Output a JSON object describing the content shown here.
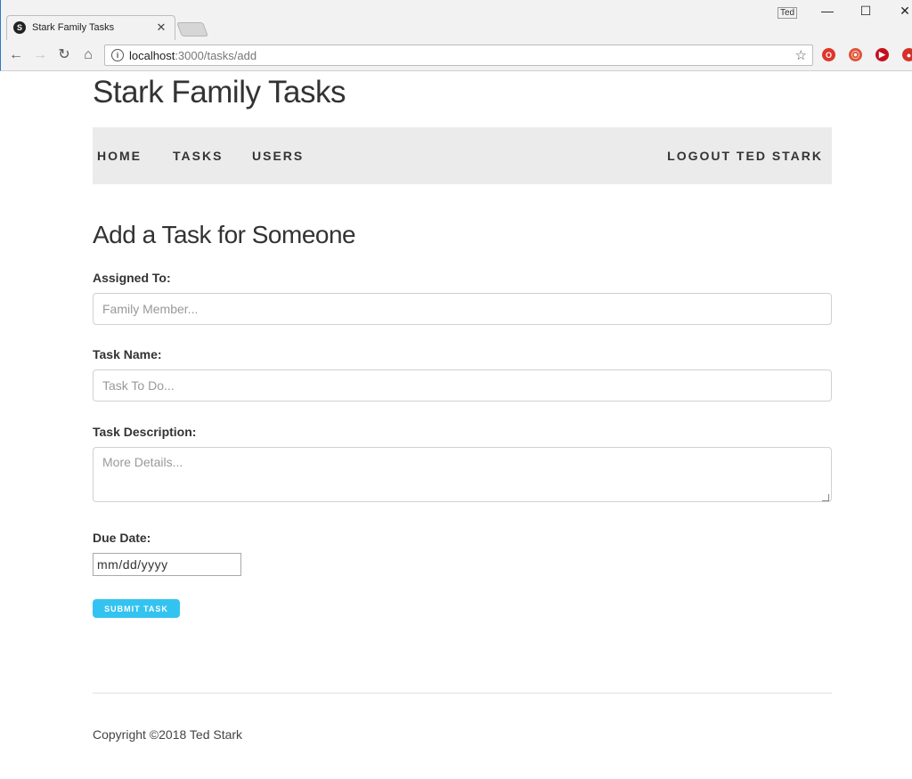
{
  "browser": {
    "tab_favicon": "S",
    "tab_title": "Stark Family Tasks",
    "tab_close": "✕",
    "profile_label": "Ted",
    "url_host": "localhost",
    "url_path": ":3000/tasks/add"
  },
  "site": {
    "title": "Stark Family Tasks"
  },
  "nav": {
    "home": "HOME",
    "tasks": "TASKS",
    "users": "USERS",
    "logout": "LOGOUT TED STARK"
  },
  "form": {
    "heading": "Add a Task for Someone",
    "assigned_label": "Assigned To:",
    "assigned_placeholder": "Family Member...",
    "name_label": "Task Name:",
    "name_placeholder": "Task To Do...",
    "description_label": "Task Description:",
    "description_placeholder": "More Details...",
    "due_label": "Due Date:",
    "due_placeholder": "mm/dd/yyyy",
    "submit_label": "SUBMIT TASK"
  },
  "footer": {
    "copyright": "Copyright ©2018 Ted Stark"
  },
  "colors": {
    "accent": "#33c3f0",
    "navbar_bg": "#ebebeb"
  }
}
